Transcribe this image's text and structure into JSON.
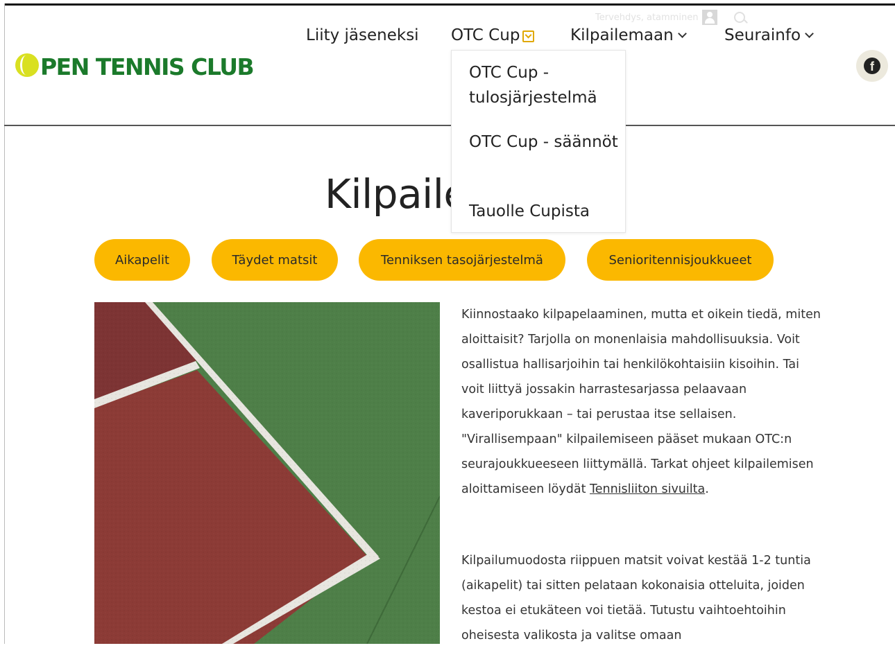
{
  "brand": {
    "logo_text": "PEN TENNIS CLUB",
    "green": "#1b7a2b",
    "yellow": "#fbb800"
  },
  "utility": {
    "greeting": "Tervehdys, atamminen",
    "icons": [
      "user-icon",
      "search-icon"
    ]
  },
  "nav": {
    "items": [
      {
        "label": "Liity jäseneksi",
        "has_caret": false
      },
      {
        "label": "OTC Cup",
        "has_caret": true,
        "expanded": true
      },
      {
        "label": "Kilpailemaan",
        "has_caret": true
      },
      {
        "label": "Seurainfo",
        "has_caret": true
      }
    ]
  },
  "dropdown": {
    "items": [
      {
        "label": "OTC Cup - tulosjärjestelmä"
      },
      {
        "label": "OTC Cup - säännöt"
      },
      {
        "label": "Tauolle Cupista"
      }
    ]
  },
  "social": {
    "facebook_glyph": "f"
  },
  "page": {
    "title": "Kilpailemaan"
  },
  "buttons": [
    {
      "label": "Aikapelit"
    },
    {
      "label": "Täydet matsit"
    },
    {
      "label": "Tenniksen tasojärjestelmä"
    },
    {
      "label": "Senioritennisjoukkueet"
    }
  ],
  "content": {
    "paragraph1_text": "Kiinnostaako kilpapelaaminen, mutta et oikein tiedä, miten aloittaisit? Tarjolla on monenlaisia mahdollisuuksia. Voit osallistua hallisarjoihin tai henkilökohtaisiin kisoihin. Tai voit liittyä jossakin harrastesarjassa pelaavaan kaveriporukkaan – tai perustaa itse sellaisen. \"Virallisempaan\" kilpailemiseen pääset mukaan OTC:n seurajoukkueeseen liittymällä. Tarkat ohjeet kilpailemisen aloittamiseen löydät",
    "paragraph1_link": "Tennisliiton sivuilta",
    "paragraph1_end": ".",
    "paragraph2": "Kilpailumuodosta riippuen matsit voivat kestää 1-2 tuntia (aikapelit) tai sitten pelataan kokonaisia otteluita, joiden kestoa ei etukäteen voi tietää. Tutustu vaihtoehtoihin oheisesta valikosta ja valitse omaan"
  }
}
